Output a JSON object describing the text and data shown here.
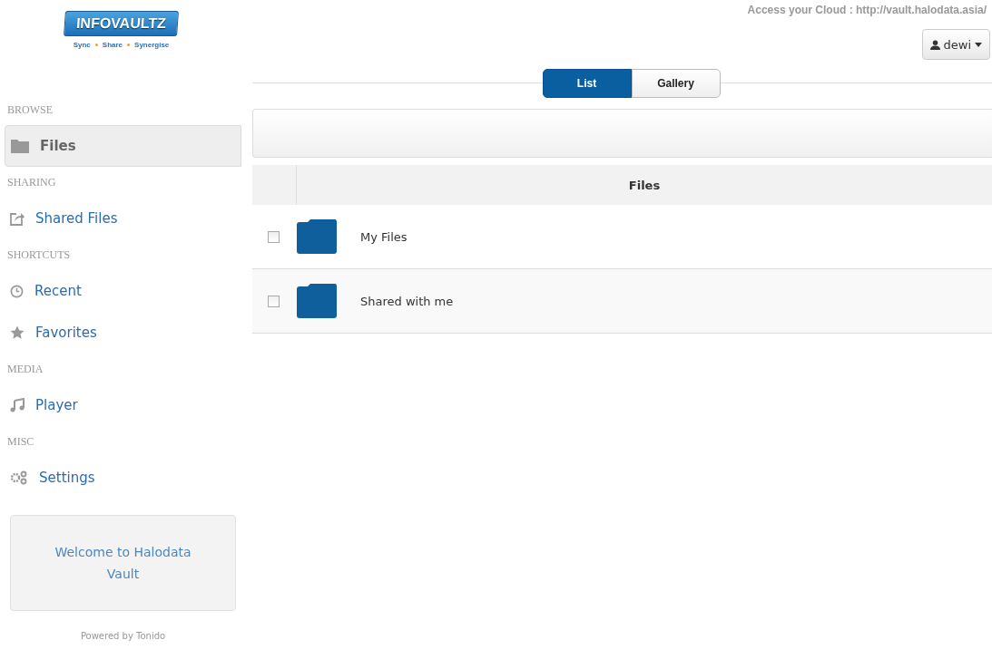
{
  "logo": {
    "name": "INFOVAULTZ",
    "tagline": [
      "Sync",
      "Share",
      "Synergise"
    ]
  },
  "header": {
    "access_text": "Access your Cloud : http://vault.halodata.asia/",
    "user": "dewi"
  },
  "sidebar": {
    "items": [
      {
        "kind": "section",
        "label": "BROWSE"
      },
      {
        "kind": "item",
        "label": "Files",
        "selected": true
      },
      {
        "kind": "section",
        "label": "SHARING"
      },
      {
        "kind": "item",
        "label": "Shared Files",
        "selected": false
      },
      {
        "kind": "section",
        "label": "SHORTCUTS"
      },
      {
        "kind": "item",
        "label": "Recent",
        "selected": false
      },
      {
        "kind": "item",
        "label": "Favorites",
        "selected": false
      },
      {
        "kind": "section",
        "label": "MEDIA"
      },
      {
        "kind": "item",
        "label": "Player",
        "selected": false
      },
      {
        "kind": "section",
        "label": "MISC"
      },
      {
        "kind": "item",
        "label": "Settings",
        "selected": false
      }
    ],
    "welcome": "Welcome to Halodata Vault",
    "footer": "Powered by Tonido"
  },
  "view_tabs": [
    {
      "label": "List",
      "selected": true
    },
    {
      "label": "Gallery",
      "selected": false
    }
  ],
  "table": {
    "columns": [
      "Files"
    ],
    "rows": [
      {
        "name": "My Files",
        "checked": false
      },
      {
        "name": "Shared with me",
        "checked": false
      }
    ]
  }
}
